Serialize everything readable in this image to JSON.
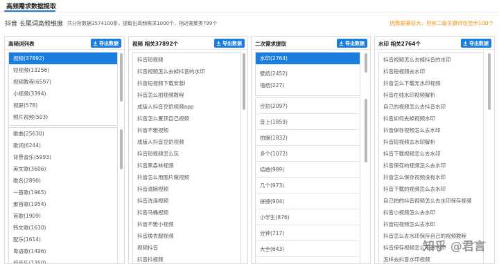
{
  "page": {
    "title": "高频需求数据提取",
    "subheading": "抖音 长尾词高频维度",
    "stats": "共分析数据3574100条，提取出高频需求1000个，相近需聚类799个",
    "notice": "因数据量较大，目前二级关键词仅显示100个"
  },
  "export_label": "导出数据",
  "colors": {
    "accent": "#1a7de0",
    "notice": "#f0900f"
  },
  "panels": {
    "high": {
      "title": "高频词列表",
      "top_items": [
        "视频(37892)",
        "短视频(13256)",
        "视频教程(6597)",
        "小视频(3394)",
        "视屏(578)",
        "照片视频(503)"
      ],
      "bottom_items": [
        "歌曲(25630)",
        "歌词(6244)",
        "背景音乐(5993)",
        "英文歌(3606)",
        "歌名(2890)",
        "一首歌(1965)",
        "那首歌(1954)",
        "首歌(1909)",
        "韩文歌(1630)",
        "配乐(1614)",
        "粤语歌(1496)",
        "纯音乐(1350)"
      ]
    },
    "video": {
      "title": "视频 相关37892个",
      "items": [
        "抖音短视频",
        "抖音视频怎么去掉抖音的水印",
        "抖音短视频下载安装i",
        "抖音怎么拍视频教程",
        "成版人抖音豆奶视频app",
        "抖音怎么置顶自己视频",
        "抖音不雅视频",
        "成版人抖音豆奶视频",
        "抖音短视频怎么玩",
        "抖音黑森林视频",
        "抖音怎么用图片做视频",
        "抖音温婉视频",
        "抖音洗澡视频",
        "抖音马桶视频",
        "抖音不雅小视频",
        "抖音换衣服视频",
        "视频抖音",
        "抖音抖视频"
      ]
    },
    "secondary": {
      "title": "二次需求提取",
      "items": [
        "水印(2764)",
        "壁纸(2452)",
        "墙纸(227)",
        "合拍(2097)",
        "音上(1859)",
        "拍摄(1832)",
        "多个(1072)",
        "结婚(989)",
        "几个(973)",
        "拼接(904)",
        "小学生(876)",
        "分钟(717)",
        "大全(643)"
      ]
    },
    "watermark": {
      "title": "水印 相关2764个",
      "items": [
        "抖音视频怎么去掉抖音的水印",
        "抖音短视频去水印",
        "抖音怎么下载无水印视频",
        "抖音在线水印视频解析",
        "自己的视频怎么去抖音水印",
        "抖音如何去掉视频水印",
        "抖音保存视频怎么去水印",
        "抖音短视频去水印解析",
        "抖音下载视频怎么去水印",
        "抖音保存的视频怎么去水印",
        "抖音怎么保存视频没有水印",
        "抖音下载的视频怎么去水印",
        "自己拍的抖音视频怎么去水印保存视频",
        "抖音小视频怎么去水印",
        "抖音短视频怎么去水印",
        "抖音怎么去水印保存自己的视频教程",
        "抖音保存视频怎么不带水印",
        "怎样去抖音水印视频"
      ]
    }
  },
  "watermark_text": "知乎 @君言"
}
